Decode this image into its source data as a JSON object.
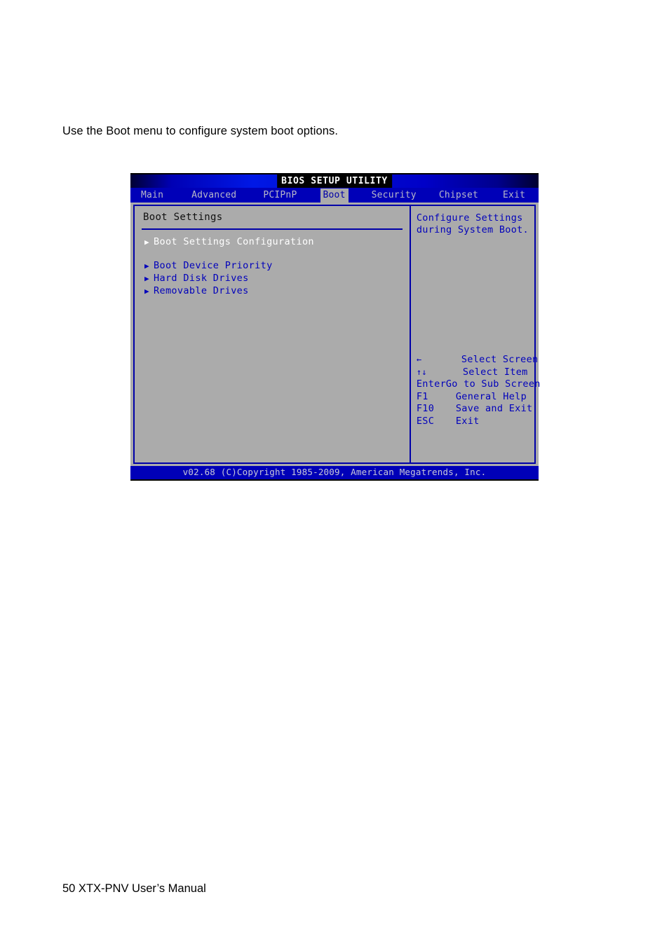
{
  "document": {
    "intro": "Use the Boot menu to configure system boot options.",
    "footer": "50 XTX-PNV User’s Manual"
  },
  "bios": {
    "title": "BIOS SETUP UTILITY",
    "menu": [
      {
        "label": "Main",
        "active": false
      },
      {
        "label": "Advanced",
        "active": false
      },
      {
        "label": "PCIPnP",
        "active": false
      },
      {
        "label": "Boot",
        "active": true
      },
      {
        "label": "Security",
        "active": false
      },
      {
        "label": "Chipset",
        "active": false
      },
      {
        "label": "Exit",
        "active": false
      }
    ],
    "left_panel": {
      "section_title": "Boot Settings",
      "options": [
        {
          "label": "Boot Settings Configuration",
          "selected": true,
          "arrow": "▶"
        },
        {
          "label": "Boot Device Priority",
          "selected": false,
          "arrow": "▶"
        },
        {
          "label": "Hard Disk Drives",
          "selected": false,
          "arrow": "▶"
        },
        {
          "label": "Removable Drives",
          "selected": false,
          "arrow": "▶"
        }
      ]
    },
    "right_panel": {
      "help_line_1": "Configure Settings",
      "help_line_2": "during System Boot.",
      "legend": [
        {
          "key": "←",
          "desc": "Select Screen"
        },
        {
          "key": "↑↓",
          "desc": "Select Item"
        },
        {
          "key": "Enter",
          "desc": "Go to Sub Screen"
        },
        {
          "key": "F1",
          "desc": "General Help"
        },
        {
          "key": "F10",
          "desc": "Save and Exit"
        },
        {
          "key": "ESC",
          "desc": "Exit"
        }
      ]
    },
    "footer": "v02.68 (C)Copyright 1985-2009, American Megatrends, Inc.",
    "colors": {
      "chrome_blue": "#0000b8",
      "text_blue": "#0000bb",
      "panel_gray": "#ababab",
      "selected_text": "#ffffff"
    }
  }
}
